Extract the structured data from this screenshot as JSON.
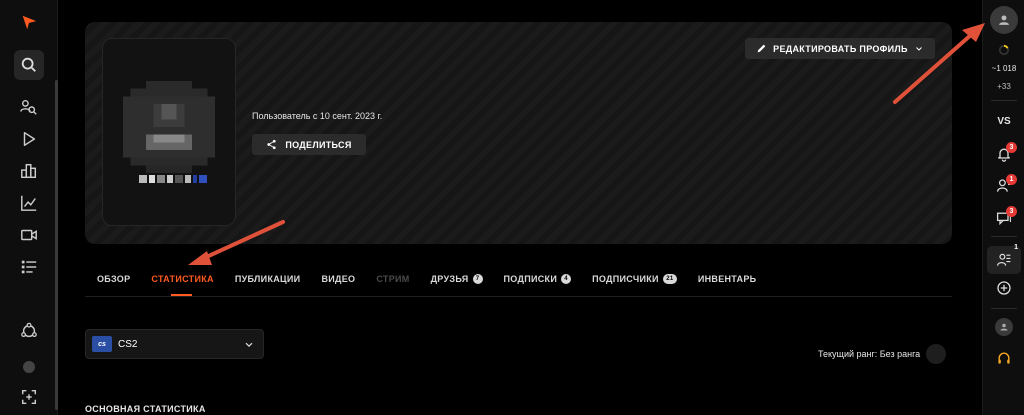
{
  "colors": {
    "accent": "#ff5a1f",
    "badge": "#e53935",
    "arrow": "#e0513a",
    "headset": "#f5a623"
  },
  "left_sidebar": {
    "items": [
      {
        "name": "logo-icon"
      },
      {
        "name": "search-icon"
      },
      {
        "name": "players-search-icon"
      },
      {
        "name": "play-icon"
      },
      {
        "name": "leaderboard-icon"
      },
      {
        "name": "stats-chart-icon"
      },
      {
        "name": "video-icon"
      },
      {
        "name": "list-icon"
      },
      {
        "name": "network-icon"
      },
      {
        "name": "expand-icon"
      }
    ]
  },
  "right_sidebar": {
    "elo": "~1 018",
    "elo_delta": "+33",
    "vs_label": "VS",
    "notifications_badge": "3",
    "friends_badge": "1",
    "chats_badge": "3",
    "group_badge": "1"
  },
  "profile": {
    "member_since": "Пользователь с 10 сент. 2023 г.",
    "share_label": "ПОДЕЛИТЬСЯ",
    "edit_label": "РЕДАКТИРОВАТЬ ПРОФИЛЬ"
  },
  "tabs": [
    {
      "label": "ОБЗОР",
      "state": "normal"
    },
    {
      "label": "СТАТИСТИКА",
      "state": "active"
    },
    {
      "label": "ПУБЛИКАЦИИ",
      "state": "normal"
    },
    {
      "label": "ВИДЕО",
      "state": "normal"
    },
    {
      "label": "СТРИМ",
      "state": "disabled"
    },
    {
      "label": "ДРУЗЬЯ",
      "count": "7",
      "state": "normal"
    },
    {
      "label": "ПОДПИСКИ",
      "count": "4",
      "state": "normal"
    },
    {
      "label": "ПОДПИСЧИКИ",
      "count": "21",
      "state": "normal"
    },
    {
      "label": "ИНВЕНТАРЬ",
      "state": "normal"
    }
  ],
  "game_select": {
    "logo_text": "cs",
    "value": "CS2"
  },
  "rank_text": "Текущий ранг: Без ранга",
  "section_title": "ОСНОВНАЯ СТАТИСТИКА"
}
